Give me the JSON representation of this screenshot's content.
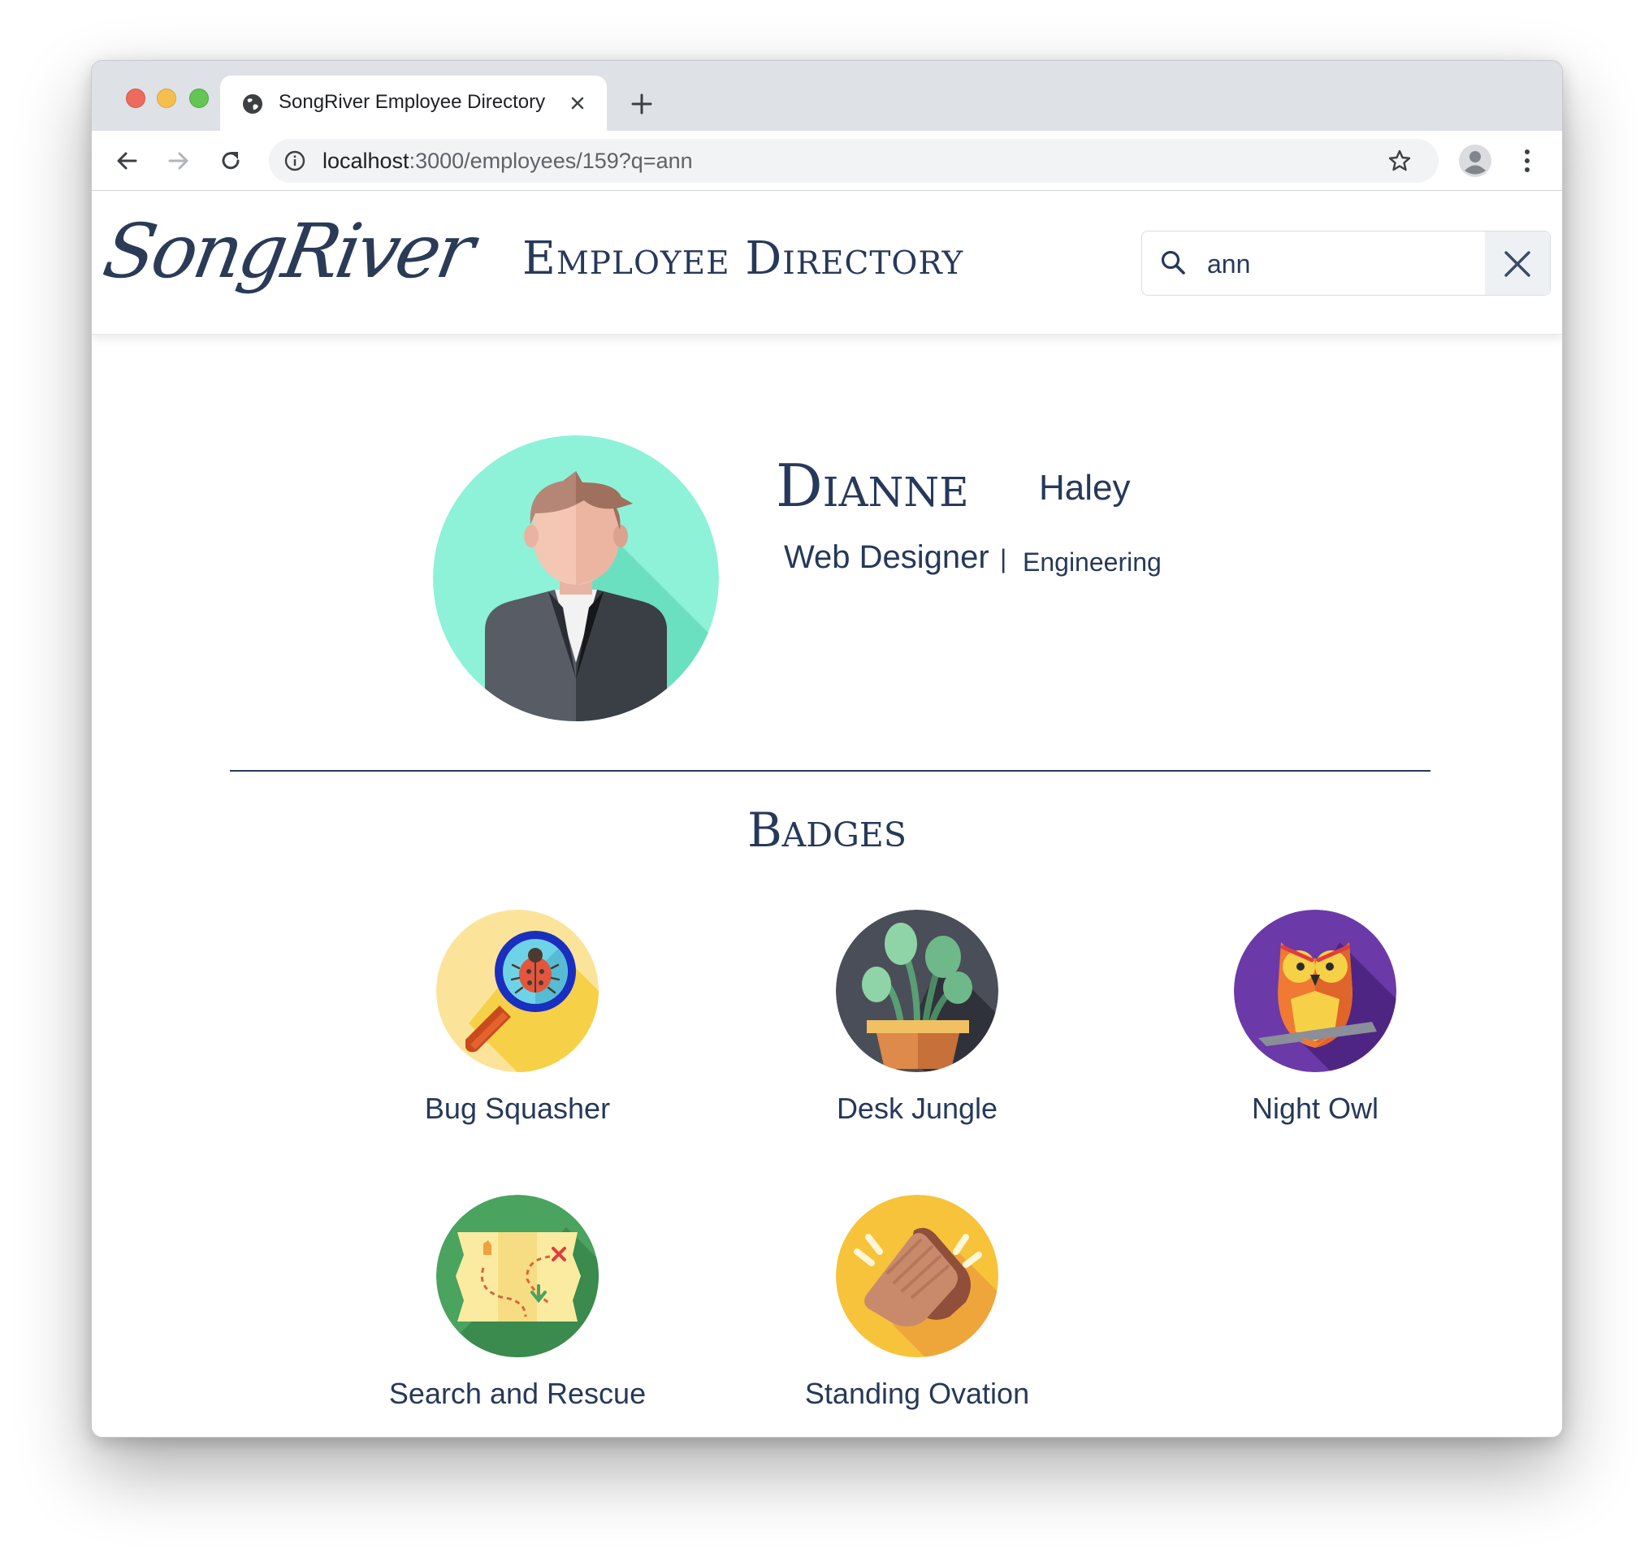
{
  "browser": {
    "tab_title": "SongRiver Employee Directory",
    "url_host": "localhost",
    "url_rest": ":3000/employees/159?q=ann"
  },
  "header": {
    "logo_text": "SongRiver",
    "title": "Employee Directory",
    "search_value": "ann"
  },
  "employee": {
    "first_name": "Dianne",
    "last_name": "Haley",
    "job_title": "Web Designer",
    "separator": "|",
    "department": "Engineering"
  },
  "badges_heading": "Badges",
  "badges": [
    {
      "label": "Bug Squasher",
      "icon": "magnifier-ladybug-icon",
      "color": "#f6d047"
    },
    {
      "label": "Desk Jungle",
      "icon": "potted-plant-icon",
      "color": "#3b3f4a"
    },
    {
      "label": "Night Owl",
      "icon": "owl-icon",
      "color": "#5b2d8e"
    },
    {
      "label": "Search and Rescue",
      "icon": "treasure-map-icon",
      "color": "#3f9a57"
    },
    {
      "label": "Standing Ovation",
      "icon": "clapping-hands-icon",
      "color": "#f6c33a"
    }
  ],
  "colors": {
    "brand_navy": "#26395a"
  }
}
